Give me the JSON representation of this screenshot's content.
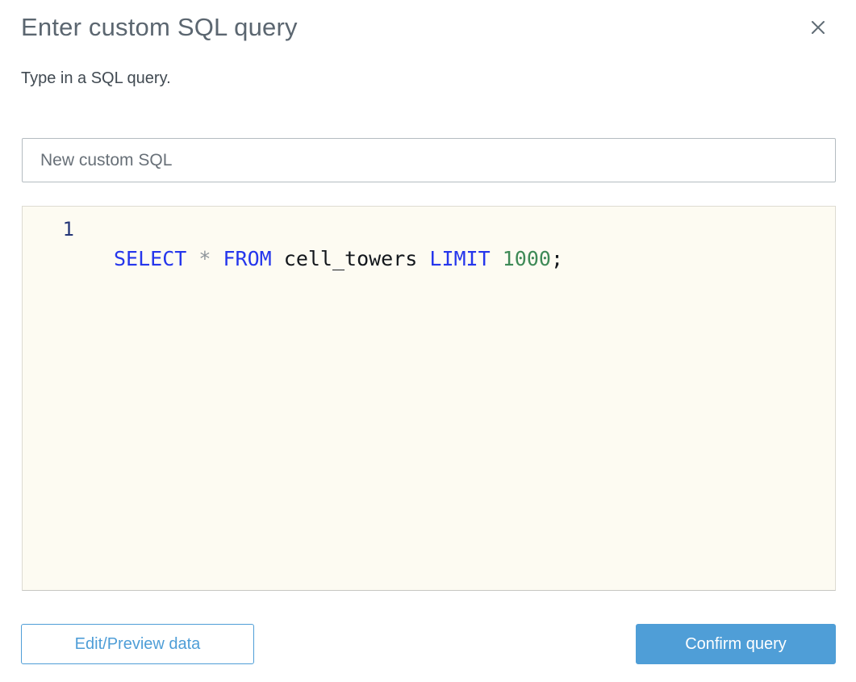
{
  "dialog": {
    "title": "Enter custom SQL query",
    "subtitle": "Type in a SQL query.",
    "close_icon": "x-close-icon"
  },
  "name_input": {
    "value": "New custom SQL"
  },
  "editor": {
    "query": "SELECT * FROM cell_towers LIMIT 1000;",
    "lines": [
      {
        "number": "1",
        "tokens": [
          {
            "text": "SELECT",
            "type": "keyword"
          },
          {
            "text": " ",
            "type": "plain"
          },
          {
            "text": "*",
            "type": "operator"
          },
          {
            "text": " ",
            "type": "plain"
          },
          {
            "text": "FROM",
            "type": "keyword"
          },
          {
            "text": " cell_towers ",
            "type": "plain"
          },
          {
            "text": "LIMIT",
            "type": "keyword"
          },
          {
            "text": " ",
            "type": "plain"
          },
          {
            "text": "1000",
            "type": "number"
          },
          {
            "text": ";",
            "type": "plain"
          }
        ]
      }
    ]
  },
  "buttons": {
    "secondary_label": "Edit/Preview data",
    "primary_label": "Confirm query"
  },
  "colors": {
    "accent": "#4f9ed7",
    "title": "#5b6670",
    "subtitle": "#414a52",
    "input-text": "#687078",
    "editor-bg": "#fdfbf2",
    "line-number": "#263778",
    "keyword": "#2536ec",
    "operator": "#8e959b",
    "number": "#3e8a57",
    "plain": "#13171c"
  }
}
